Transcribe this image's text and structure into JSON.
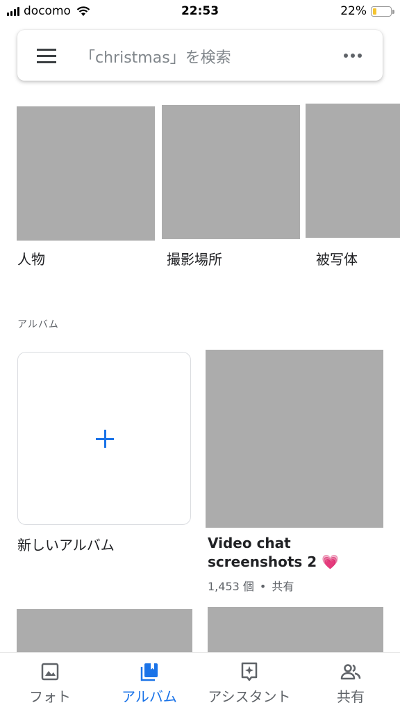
{
  "status_bar": {
    "carrier": "docomo",
    "time": "22:53",
    "battery_percent": "22%",
    "battery_level": 0.22,
    "battery_color": "#f4c430"
  },
  "search": {
    "placeholder": "「christmas」を検索",
    "menu_icon": "hamburger-menu-icon",
    "more_icon": "more-horizontal-icon"
  },
  "categories": [
    {
      "label": "人物"
    },
    {
      "label": "撮影場所"
    },
    {
      "label": "被写体"
    }
  ],
  "albums_section": {
    "title": "アルバム",
    "new_album_label": "新しいアルバム",
    "albums": [
      {
        "title": "Video chat screenshots 2",
        "emoji": "💗",
        "count": "1,453 個",
        "shared": "共有"
      }
    ]
  },
  "bottom_nav": {
    "accent_color": "#1a73e8",
    "items": [
      {
        "label": "フォト",
        "icon": "photo-icon",
        "active": false
      },
      {
        "label": "アルバム",
        "icon": "album-icon",
        "active": true
      },
      {
        "label": "アシスタント",
        "icon": "assistant-icon",
        "active": false
      },
      {
        "label": "共有",
        "icon": "people-icon",
        "active": false
      }
    ]
  }
}
